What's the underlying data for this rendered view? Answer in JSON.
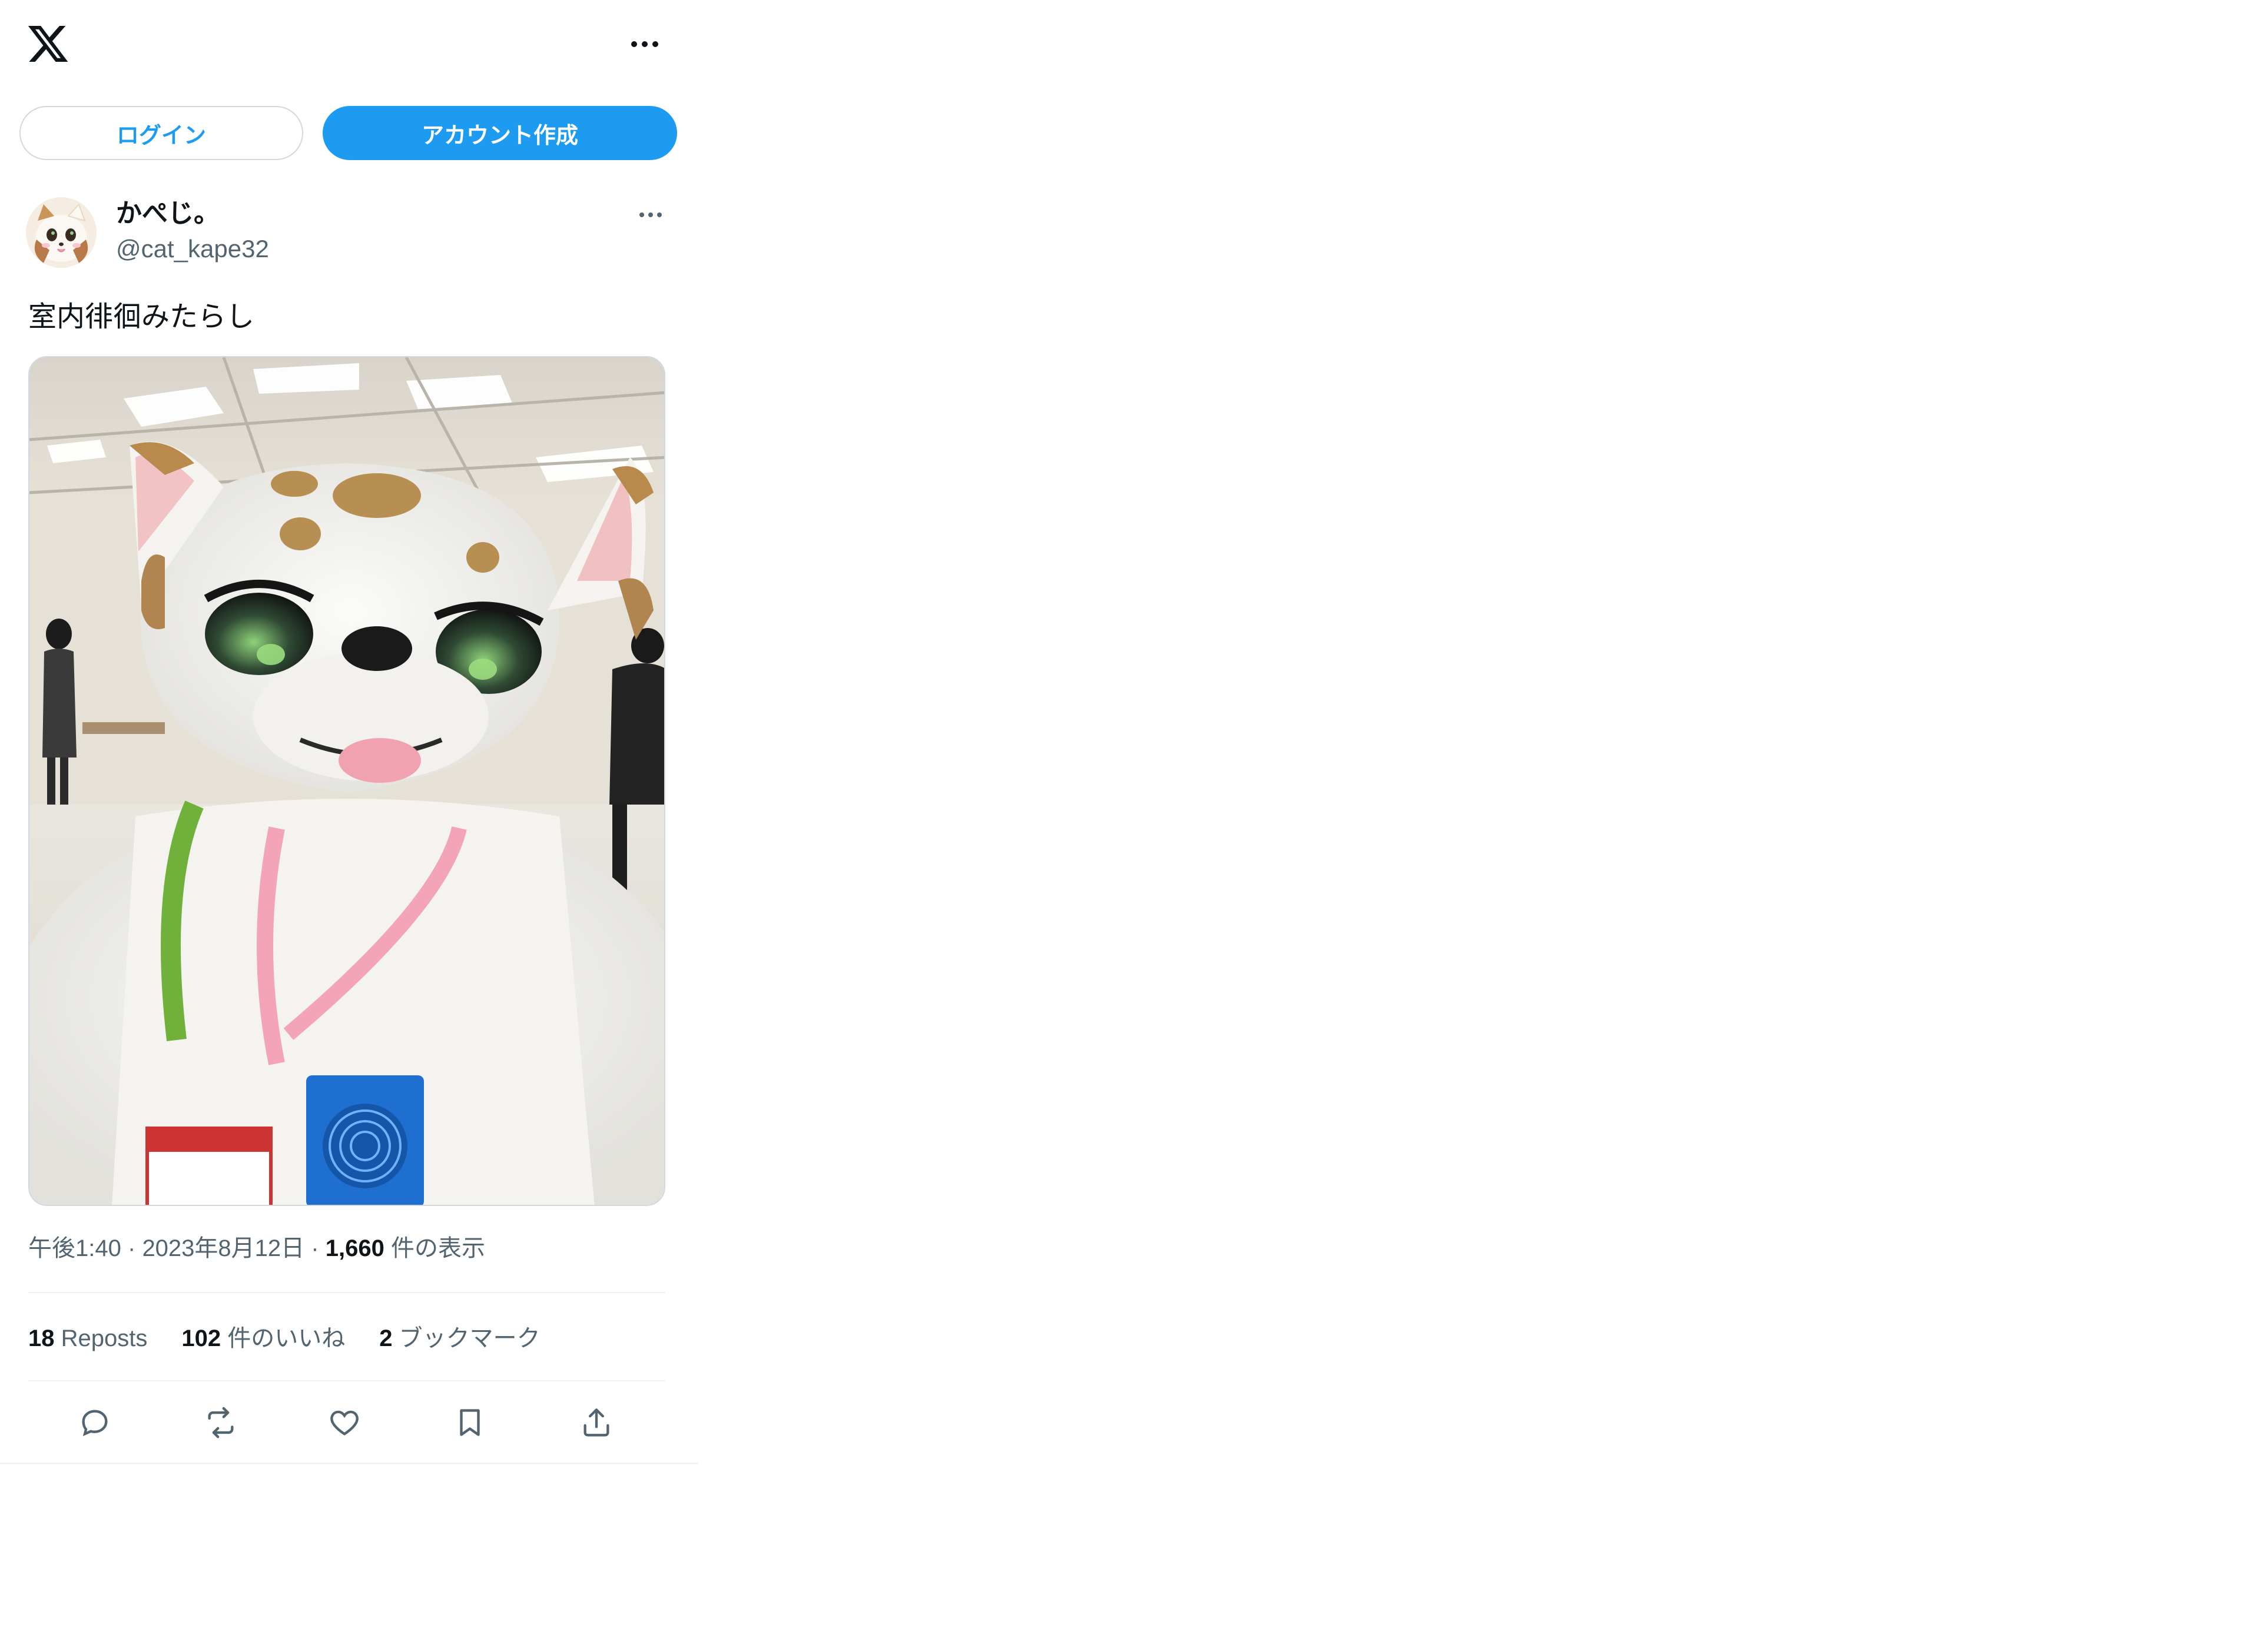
{
  "header": {
    "logo": "x-logo-icon",
    "more": "more-icon"
  },
  "auth": {
    "login_label": "ログイン",
    "signup_label": "アカウント作成"
  },
  "post": {
    "author_name": "かぺじ。",
    "author_handle": "@cat_kape32",
    "text": "室内徘徊みたらし",
    "media_description": "photo",
    "time": "午後1:40",
    "date": "2023年8月12日",
    "views_count": "1,660",
    "views_label": "件の表示",
    "separator": "·"
  },
  "stats": {
    "reposts_count": "18",
    "reposts_label": "Reposts",
    "likes_count": "102",
    "likes_label": "件のいいね",
    "bookmarks_count": "2",
    "bookmarks_label": "ブックマーク"
  },
  "actions": [
    "reply-icon",
    "repost-icon",
    "like-icon",
    "bookmark-icon",
    "share-icon"
  ],
  "colors": {
    "accent": "#1d9bf0",
    "text": "#0f1419",
    "secondary": "#536471",
    "border": "#cfd9de"
  }
}
